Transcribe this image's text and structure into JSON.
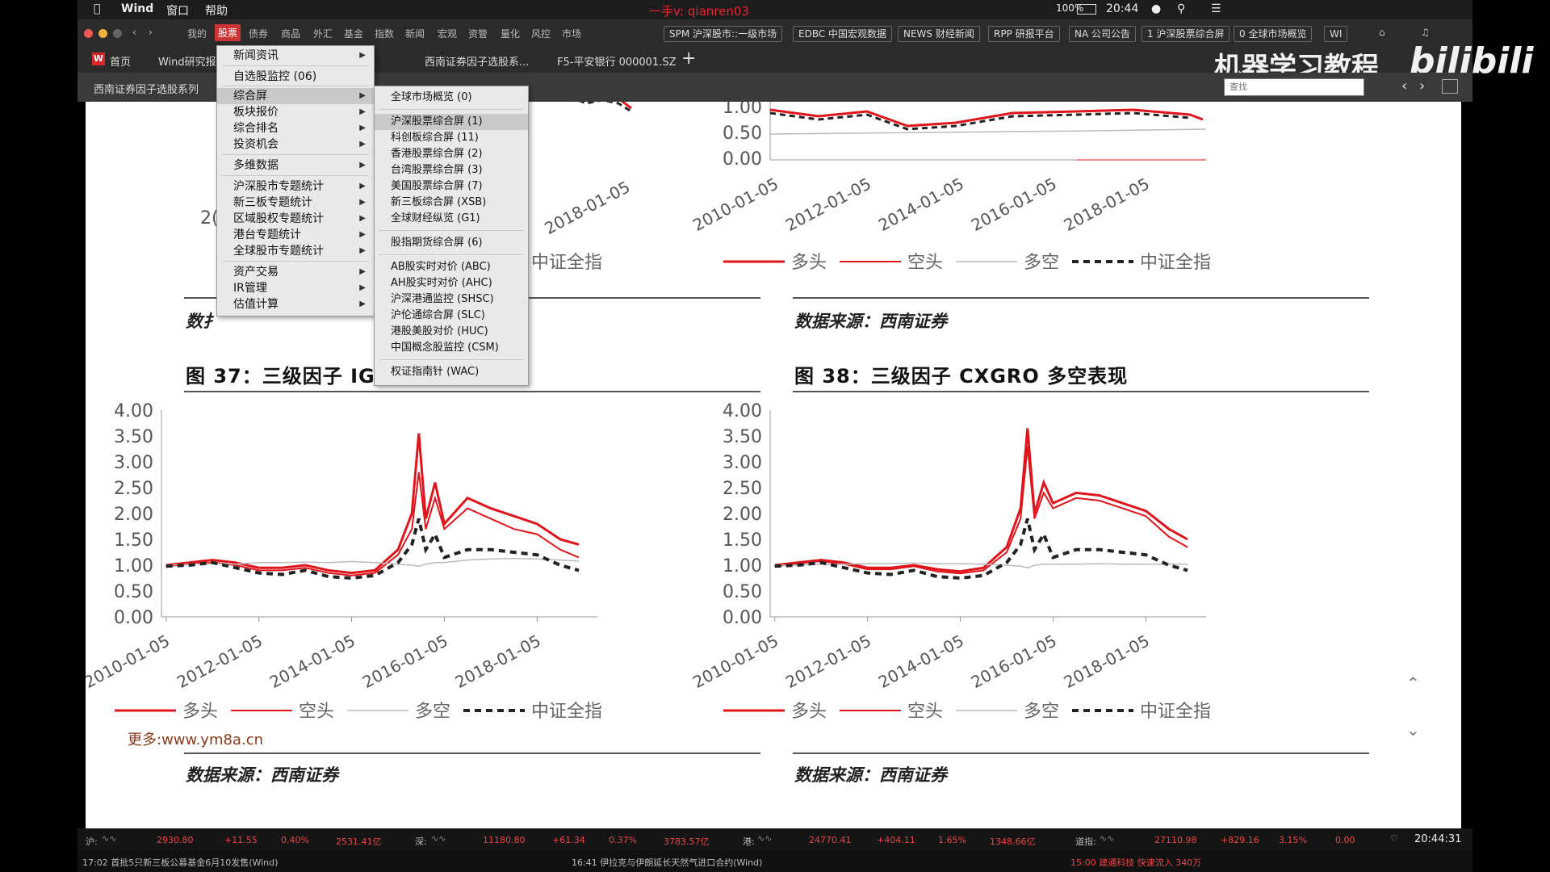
{
  "menubar": {
    "app": "Wind",
    "items": [
      "窗口",
      "帮助"
    ],
    "center_text": "一手v: qianren03",
    "battery": "100%",
    "time": "20:44"
  },
  "toolbar": {
    "menus": [
      "我的",
      "股票",
      "债券",
      "商品",
      "外汇",
      "基金",
      "指数",
      "新闻",
      "宏观",
      "资管",
      "量化",
      "风控",
      "市场"
    ],
    "buttons": [
      "SPM 沪深股市::一级市场",
      "EDBC 中国宏观数据",
      "NEWS 财经新闻",
      "RPP 研报平台",
      "NA 公司公告",
      "1 沪深股票综合屏",
      "0 全球市场概览",
      "WI"
    ]
  },
  "tabs": {
    "items": [
      "首页",
      "Wind研究报",
      "西南证券因子选股系...",
      "F5-平安银行 000001.SZ"
    ],
    "add": "+"
  },
  "watermark": {
    "text": "机器学习教程",
    "logo": "bilibili"
  },
  "subbar": {
    "breadcrumb": "西南证券因子选股系列",
    "search_placeholder": "查找"
  },
  "menu_main": {
    "items": [
      {
        "label": "新闻资讯",
        "arrow": true
      },
      {
        "label": "自选股监控 (06)",
        "arrow": false
      },
      {
        "label": "综合屏",
        "arrow": true,
        "highlight": true
      },
      {
        "label": "板块报价",
        "arrow": true
      },
      {
        "label": "综合排名",
        "arrow": true
      },
      {
        "label": "投资机会",
        "arrow": true
      },
      {
        "label": "多维数据",
        "arrow": true
      },
      {
        "label": "沪深股市专题统计",
        "arrow": true
      },
      {
        "label": "新三板专题统计",
        "arrow": true
      },
      {
        "label": "区域股权专题统计",
        "arrow": true
      },
      {
        "label": "港台专题统计",
        "arrow": true
      },
      {
        "label": "全球股市专题统计",
        "arrow": true
      },
      {
        "label": "资产交易",
        "arrow": true
      },
      {
        "label": "IR管理",
        "arrow": true
      },
      {
        "label": "估值计算",
        "arrow": true
      }
    ]
  },
  "menu_sub": {
    "items": [
      "全球市场概览 (0)",
      "沪深股票综合屏 (1)",
      "科创板综合屏 (11)",
      "香港股票综合屏 (2)",
      "台湾股票综合屏 (3)",
      "美国股票综合屏 (7)",
      "新三板综合屏 (XSB)",
      "全球财经纵览 (G1)",
      "股指期货综合屏 (6)",
      "AB股实时对价 (ABC)",
      "AH股实时对价 (AHC)",
      "沪深港通监控 (SHSC)",
      "沪伦通综合屏 (SLC)",
      "港股美股对价 (HUC)",
      "中国概念股监控 (CSM)",
      "权证指南针 (WAC)"
    ],
    "highlight_index": 1
  },
  "doc": {
    "fig37_title": "图 37：三级因子 IGF",
    "fig38_title": "图 38：三级因子 CXGRO 多空表现",
    "source": "数据来源：西南证券",
    "source_partial": "数扌",
    "watermark_link": "更多:www.ym8a.cn",
    "top_left_partial": "2(",
    "legend": [
      "多头",
      "空头",
      "多空",
      "中证全指"
    ]
  },
  "colors": {
    "long": "#e0151b",
    "short": "#e0151b",
    "longshort": "#bbbbbb",
    "index": "#222222"
  },
  "chart_data": [
    {
      "type": "line",
      "title": "",
      "xlabel": "",
      "ylabel": "",
      "ylim": [
        0,
        4
      ],
      "yticks": [
        "4.00",
        "3.50",
        "3.00",
        "2.50",
        "2.00",
        "1.50",
        "1.00",
        "0.50",
        "0.00"
      ],
      "xticks": [
        "2010-01-05",
        "2012-01-05",
        "2014-01-05",
        "2016-01-05",
        "2018-01-05"
      ],
      "x": [
        2010.0,
        2010.5,
        2011.0,
        2011.5,
        2012.0,
        2012.5,
        2013.0,
        2013.5,
        2014.0,
        2014.5,
        2015.0,
        2015.3,
        2015.45,
        2015.6,
        2015.8,
        2016.0,
        2016.5,
        2017.0,
        2017.5,
        2018.0,
        2018.5,
        2018.9
      ],
      "series": [
        {
          "name": "多头",
          "values": [
            1.0,
            1.05,
            1.1,
            1.05,
            0.95,
            0.95,
            1.0,
            0.9,
            0.85,
            0.9,
            1.3,
            2.0,
            3.55,
            1.9,
            2.6,
            1.8,
            2.3,
            2.1,
            1.95,
            1.8,
            1.5,
            1.4
          ]
        },
        {
          "name": "空头",
          "values": [
            0.98,
            1.02,
            1.05,
            1.0,
            0.9,
            0.9,
            0.95,
            0.85,
            0.8,
            0.85,
            1.2,
            1.7,
            2.8,
            1.7,
            2.3,
            1.7,
            2.1,
            1.9,
            1.7,
            1.6,
            1.3,
            1.15
          ]
        },
        {
          "name": "多空",
          "values": [
            1.0,
            1.02,
            1.03,
            1.02,
            1.05,
            1.05,
            1.06,
            1.05,
            1.07,
            1.05,
            1.02,
            1.0,
            0.98,
            1.02,
            1.05,
            1.05,
            1.1,
            1.12,
            1.13,
            1.12,
            1.1,
            1.08
          ]
        },
        {
          "name": "中证全指",
          "values": [
            0.98,
            1.0,
            1.05,
            0.95,
            0.85,
            0.82,
            0.9,
            0.78,
            0.75,
            0.8,
            1.05,
            1.4,
            1.9,
            1.3,
            1.6,
            1.15,
            1.3,
            1.3,
            1.25,
            1.2,
            1.0,
            0.9
          ]
        }
      ]
    },
    {
      "type": "line",
      "title": "",
      "xlabel": "",
      "ylabel": "",
      "ylim": [
        0,
        4
      ],
      "yticks": [
        "4.00",
        "3.50",
        "3.00",
        "2.50",
        "2.00",
        "1.50",
        "1.00",
        "0.50",
        "0.00"
      ],
      "xticks": [
        "2010-01-05",
        "2012-01-05",
        "2014-01-05",
        "2016-01-05",
        "2018-01-05"
      ],
      "x": [
        2010.0,
        2010.5,
        2011.0,
        2011.5,
        2012.0,
        2012.5,
        2013.0,
        2013.5,
        2014.0,
        2014.5,
        2015.0,
        2015.3,
        2015.45,
        2015.6,
        2015.8,
        2016.0,
        2016.5,
        2017.0,
        2017.5,
        2018.0,
        2018.5,
        2018.9
      ],
      "series": [
        {
          "name": "多头",
          "values": [
            1.0,
            1.05,
            1.1,
            1.05,
            0.95,
            0.95,
            1.0,
            0.92,
            0.88,
            0.95,
            1.35,
            2.1,
            3.65,
            2.0,
            2.6,
            2.2,
            2.4,
            2.35,
            2.2,
            2.05,
            1.7,
            1.5
          ]
        },
        {
          "name": "空头",
          "values": [
            0.98,
            1.03,
            1.08,
            1.02,
            0.92,
            0.92,
            0.98,
            0.88,
            0.84,
            0.9,
            1.25,
            1.9,
            3.3,
            1.9,
            2.4,
            2.1,
            2.3,
            2.25,
            2.1,
            1.95,
            1.55,
            1.35
          ]
        },
        {
          "name": "多空",
          "values": [
            1.0,
            1.0,
            1.02,
            1.02,
            1.03,
            1.03,
            1.04,
            1.03,
            1.03,
            1.02,
            1.0,
            0.98,
            0.95,
            1.0,
            1.02,
            1.02,
            1.02,
            1.03,
            1.02,
            1.02,
            1.02,
            1.02
          ]
        },
        {
          "name": "中证全指",
          "values": [
            0.98,
            1.0,
            1.05,
            0.95,
            0.85,
            0.82,
            0.9,
            0.78,
            0.75,
            0.8,
            1.05,
            1.4,
            1.9,
            1.3,
            1.6,
            1.15,
            1.3,
            1.3,
            1.25,
            1.2,
            1.0,
            0.9
          ]
        }
      ]
    }
  ],
  "top_charts": {
    "left_xticks": [
      "2016-01-05",
      "2018-01-05"
    ],
    "right_yticks": [
      "1.00",
      "0.50",
      "0.00"
    ],
    "right_xticks": [
      "2010-01-05",
      "2012-01-05",
      "2014-01-05",
      "2016-01-05",
      "2018-01-05"
    ]
  },
  "statusbar": {
    "sh": {
      "label": "沪:",
      "value": "2930.80",
      "change": "+11.55",
      "pct": "0.40%",
      "amount": "2531.41亿"
    },
    "sz": {
      "label": "深:",
      "value": "11180.80",
      "change": "+61.34",
      "pct": "0.37%",
      "amount": "3783.57亿"
    },
    "hk": {
      "label": "港:",
      "value": "24770.41",
      "change": "+404.11",
      "pct": "1.65%",
      "amount": "1348.66亿"
    },
    "dj": {
      "label": "道指:",
      "value": "27110.98",
      "change": "+829.16",
      "pct": "3.15%",
      "amount": "0.00"
    },
    "clock": "20:44:31",
    "news1": "17:02 首批5只新三板公募基金6月10发售(Wind)",
    "news2": "16:41 伊拉克与伊朗延长天然气进口合约(Wind)",
    "news3": "15:00 建通科技 快速流入 340万"
  }
}
